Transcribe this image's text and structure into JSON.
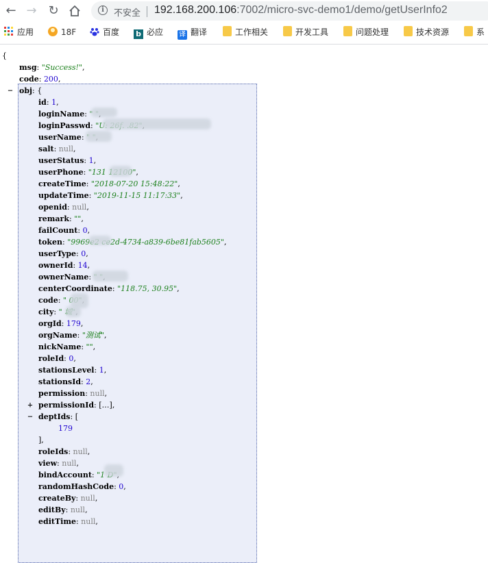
{
  "browser": {
    "security_label": "不安全",
    "url_host": "192.168.200.106",
    "url_rest": ":7002/micro-svc-demo1/demo/getUserInfo2"
  },
  "bookmarks": [
    {
      "label": "应用",
      "icon": "apps-grid-icon"
    },
    {
      "label": "18F",
      "icon": "18f-logo-icon"
    },
    {
      "label": "百度",
      "icon": "baidu-paw-icon"
    },
    {
      "label": "必应",
      "icon": "bing-logo-icon"
    },
    {
      "label": "翻译",
      "icon": "translate-icon"
    },
    {
      "label": "工作相关",
      "icon": "folder-icon"
    },
    {
      "label": "开发工具",
      "icon": "folder-icon"
    },
    {
      "label": "问题处理",
      "icon": "folder-icon"
    },
    {
      "label": "技术资源",
      "icon": "folder-icon"
    },
    {
      "label": "系",
      "icon": "folder-icon"
    }
  ],
  "json": {
    "open_brace": "{",
    "msg_key": "msg",
    "msg_val": "\"Success!\"",
    "code_key": "code",
    "code_val": "200",
    "obj_key": "obj",
    "fields": [
      {
        "k": "id",
        "v": "1",
        "t": "n"
      },
      {
        "k": "loginName",
        "v": "\"       \"",
        "t": "s"
      },
      {
        "k": "loginPasswd",
        "v": "\"U:                     26f.  .82\"",
        "t": "s"
      },
      {
        "k": "userName",
        "v": "\"    \"",
        "t": "s"
      },
      {
        "k": "salt",
        "v": "null",
        "t": "nl"
      },
      {
        "k": "userStatus",
        "v": "1",
        "t": "n"
      },
      {
        "k": "userPhone",
        "v": "\"131    12100\"",
        "t": "s"
      },
      {
        "k": "createTime",
        "v": "\"2018-07-20 15:48:22\"",
        "t": "s"
      },
      {
        "k": "updateTime",
        "v": "\"2019-11-15 11:17:33\"",
        "t": "s"
      },
      {
        "k": "openid",
        "v": "null",
        "t": "nl"
      },
      {
        "k": "remark",
        "v": "\"\"",
        "t": "s"
      },
      {
        "k": "failCount",
        "v": "0",
        "t": "n"
      },
      {
        "k": "token",
        "v": "\"9969e2    ce2d-4734-a839-6be81fab5605\"",
        "t": "s"
      },
      {
        "k": "userType",
        "v": "0",
        "t": "n"
      },
      {
        "k": "ownerId",
        "v": "14",
        "t": "n"
      },
      {
        "k": "ownerName",
        "v": "\"          \"",
        "t": "s"
      },
      {
        "k": "centerCoordinate",
        "v": "\"118.75, 30.95\"",
        "t": "s"
      },
      {
        "k": "code",
        "v": "\"    00\"",
        "t": "s"
      },
      {
        "k": "city",
        "v": "\"   城\"",
        "t": "s"
      },
      {
        "k": "orgId",
        "v": "179",
        "t": "n"
      },
      {
        "k": "orgName",
        "v": "\"测试\"",
        "t": "s"
      },
      {
        "k": "nickName",
        "v": "\"\"",
        "t": "s"
      },
      {
        "k": "roleId",
        "v": "0",
        "t": "n"
      },
      {
        "k": "stationsLevel",
        "v": "1",
        "t": "n"
      },
      {
        "k": "stationsId",
        "v": "2",
        "t": "n"
      },
      {
        "k": "permission",
        "v": "null",
        "t": "nl"
      }
    ],
    "permissionId_key": "permissionId",
    "permissionId_val": "[…],",
    "deptIds_key": "deptIds",
    "deptIds_open": "[",
    "deptIds_item": "179",
    "deptIds_close": "],",
    "fields2": [
      {
        "k": "roleIds",
        "v": "null",
        "t": "nl"
      },
      {
        "k": "view",
        "v": "null",
        "t": "nl"
      },
      {
        "k": "bindAccount",
        "v": "\"1    D\"",
        "t": "s"
      },
      {
        "k": "randomHashCode",
        "v": "0",
        "t": "n"
      },
      {
        "k": "createBy",
        "v": "null",
        "t": "nl"
      },
      {
        "k": "editBy",
        "v": "null",
        "t": "nl"
      },
      {
        "k": "editTime",
        "v": "null",
        "t": "nl"
      }
    ],
    "expand_symbol": "+",
    "collapse_symbol": "−"
  }
}
